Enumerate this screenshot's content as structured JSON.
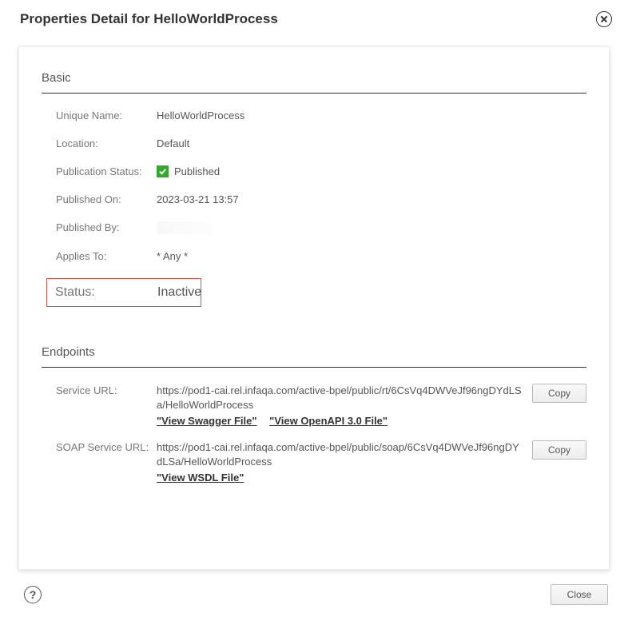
{
  "dialog": {
    "title": "Properties Detail for HelloWorldProcess",
    "close_label": "Close"
  },
  "sections": {
    "basic": {
      "title": "Basic",
      "rows": {
        "unique_name": {
          "label": "Unique Name:",
          "value": "HelloWorldProcess"
        },
        "location": {
          "label": "Location:",
          "value": "Default"
        },
        "publication_status": {
          "label": "Publication Status:",
          "value": "Published"
        },
        "published_on": {
          "label": "Published On:",
          "value": "2023-03-21 13:57"
        },
        "published_by": {
          "label": "Published By:",
          "value": ""
        },
        "applies_to": {
          "label": "Applies To:",
          "value": "* Any *"
        },
        "status": {
          "label": "Status:",
          "value": "Inactive"
        }
      }
    },
    "endpoints": {
      "title": "Endpoints",
      "copy_label": "Copy",
      "service_url": {
        "label": "Service URL:",
        "value": "https://pod1-cai.rel.infaqa.com/active-bpel/public/rt/6CsVq4DWVeJf96ngDYdLSa/HelloWorldProcess",
        "swagger_link": "\"View Swagger File\"",
        "openapi_link": "\"View OpenAPI 3.0 File\""
      },
      "soap_url": {
        "label": "SOAP Service URL:",
        "value": "https://pod1-cai.rel.infaqa.com/active-bpel/public/soap/6CsVq4DWVeJf96ngDYdLSa/HelloWorldProcess",
        "wsdl_link": "\"View WSDL File\""
      }
    }
  }
}
